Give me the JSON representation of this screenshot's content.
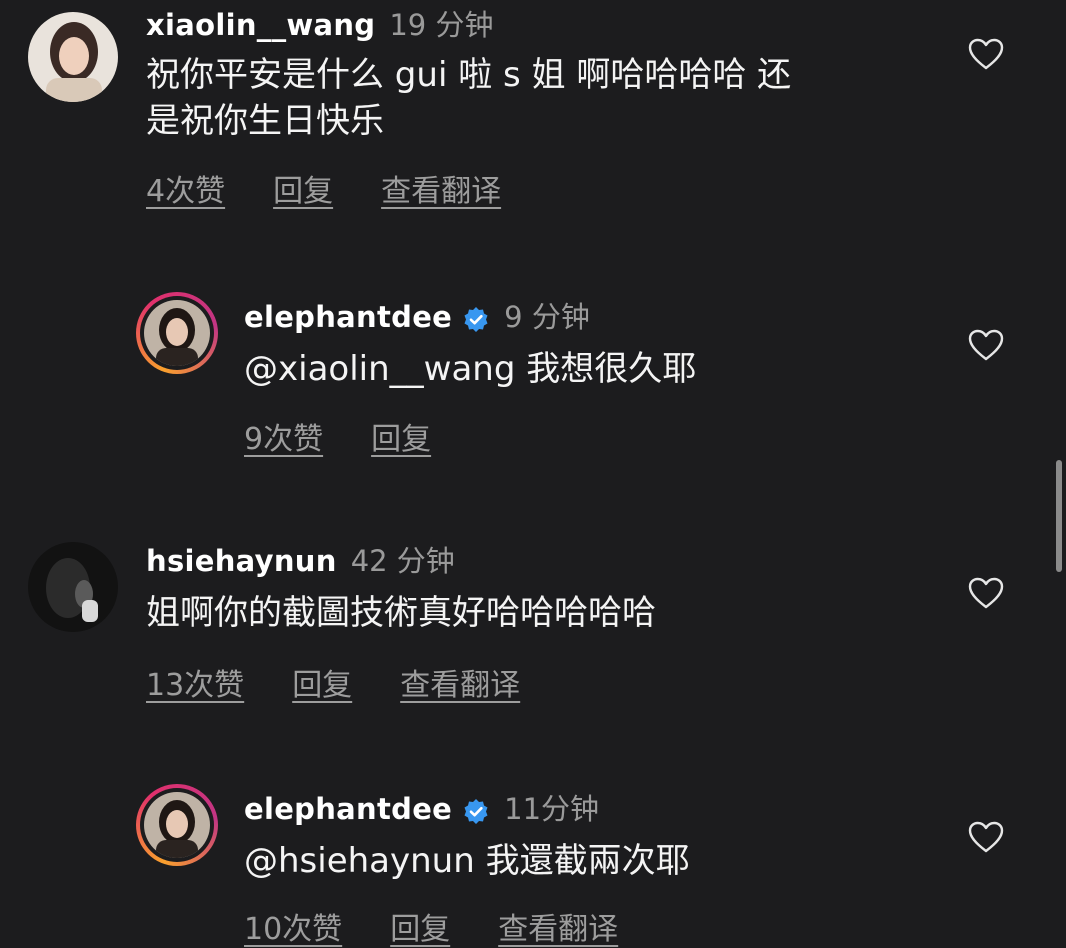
{
  "comments": [
    {
      "username": "xiaolin__wang",
      "time": "19 分钟",
      "text_line1": "祝你平安是什么 gui 啦 s 姐 啊哈哈哈哈 还",
      "text_line2": "是祝你生日快乐",
      "likes": "4次赞",
      "reply": "回复",
      "translate": "查看翻译"
    },
    {
      "username": "elephantdee",
      "time": "9 分钟",
      "text": "@xiaolin__wang 我想很久耶",
      "likes": "9次赞",
      "reply": "回复"
    },
    {
      "username": "hsiehaynun",
      "time": "42 分钟",
      "text": "姐啊你的截圖技術真好哈哈哈哈哈",
      "likes": "13次赞",
      "reply": "回复",
      "translate": "查看翻译"
    },
    {
      "username": "elephantdee",
      "time": "11分钟",
      "text": "@hsiehaynun 我還截兩次耶",
      "likes": "10次赞",
      "reply": "回复",
      "translate": "查看翻译"
    }
  ],
  "colors": {
    "background": "#1c1c1e",
    "secondary_text": "#9d9d9d",
    "verified_badge": "#3897f0"
  },
  "icons": [
    "heart-icon",
    "verified-badge-icon"
  ]
}
